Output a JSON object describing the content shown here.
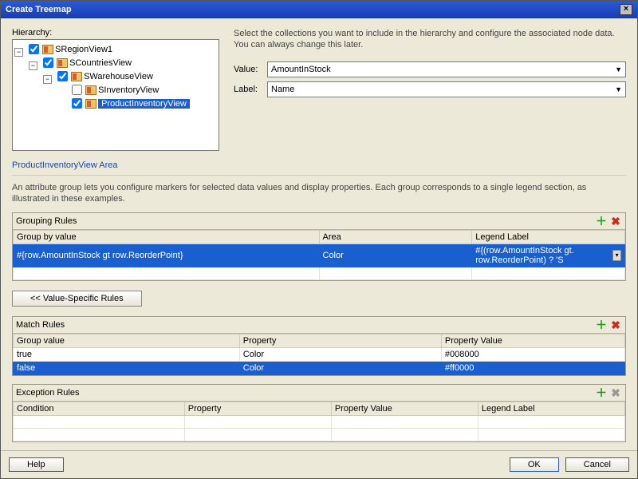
{
  "title": "Create Treemap",
  "hierarchy_label": "Hierarchy:",
  "tree": {
    "n0": "SRegionView1",
    "n1": "SCountriesView",
    "n2": "SWarehouseView",
    "n3": "SInventoryView",
    "n4": "ProductInventoryView"
  },
  "instruction": "Select the collections you want to include in the hierarchy and configure the associated node data. You can always change this later.",
  "value_label": "Value:",
  "value_choice": "AmountInStock",
  "label_label": "Label:",
  "label_choice": "Name",
  "section_area": "ProductInventoryView Area",
  "area_desc": "An attribute group lets you configure markers for selected data values and display properties. Each group corresponds to a single legend section, as illustrated in these examples.",
  "grouping": {
    "title": "Grouping Rules",
    "cols": {
      "c1": "Group by value",
      "c2": "Area",
      "c3": "Legend Label"
    },
    "row": {
      "c1": "#{row.AmountInStock gt row.ReorderPoint}",
      "c2": "Color",
      "c3": "#{(row.AmountInStock gt. row.ReorderPoint) ? 'S"
    }
  },
  "value_rules_btn": "<< Value-Specific Rules",
  "match": {
    "title": "Match Rules",
    "cols": {
      "c1": "Group value",
      "c2": "Property",
      "c3": "Property Value"
    },
    "r1": {
      "c1": "true",
      "c2": "Color",
      "c3": "#008000"
    },
    "r2": {
      "c1": "false",
      "c2": "Color",
      "c3": "#ff0000"
    }
  },
  "exception": {
    "title": "Exception Rules",
    "cols": {
      "c1": "Condition",
      "c2": "Property",
      "c3": "Property Value",
      "c4": "Legend Label"
    }
  },
  "buttons": {
    "help": "Help",
    "ok": "OK",
    "cancel": "Cancel"
  }
}
